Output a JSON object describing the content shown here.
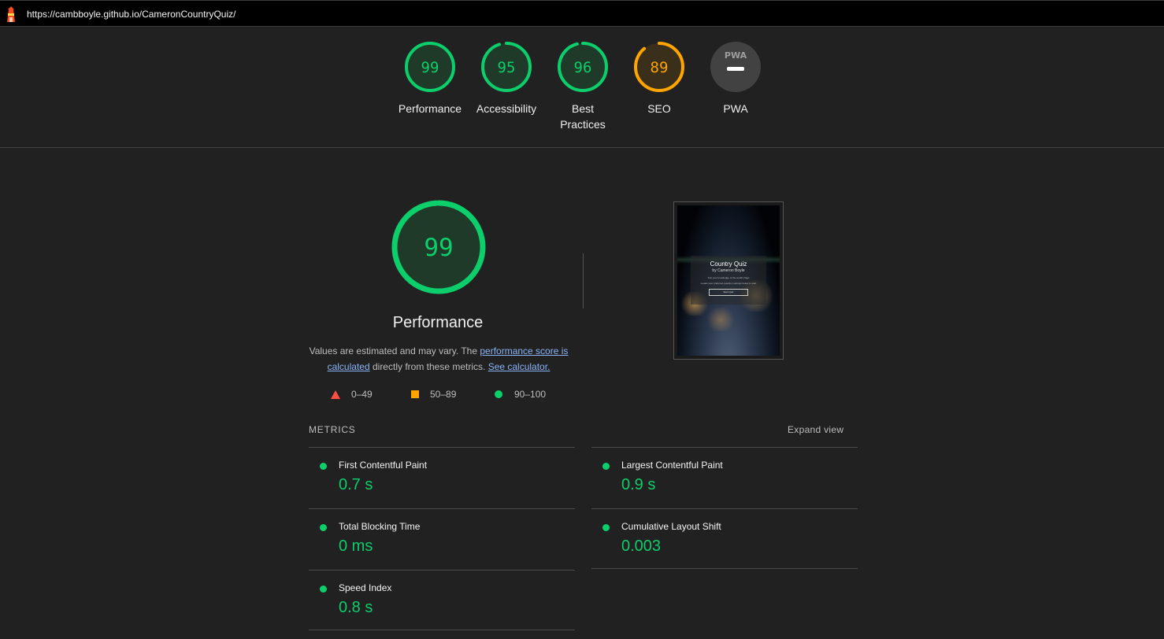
{
  "topbar": {
    "url": "https://cambboyle.github.io/CameronCountryQuiz/"
  },
  "colors": {
    "pass": "#0cce6b",
    "average": "#ffa400",
    "fail": "#ff4e42",
    "pwa": "#9e9e9e"
  },
  "gauges": [
    {
      "score": "99",
      "value": 99,
      "label": "Performance",
      "status": "pass"
    },
    {
      "score": "95",
      "value": 95,
      "label": "Accessibility",
      "status": "pass"
    },
    {
      "score": "96",
      "value": 96,
      "label": "Best Practices",
      "status": "pass"
    },
    {
      "score": "89",
      "value": 89,
      "label": "SEO",
      "status": "average"
    },
    {
      "badge": "PWA",
      "label": "PWA",
      "status": "pwa"
    }
  ],
  "performance": {
    "score": "99",
    "value": 99,
    "title": "Performance",
    "desc_prefix": "Values are estimated and may vary. The ",
    "desc_link1": "performance score is calculated",
    "desc_middle": " directly from these metrics. ",
    "desc_link2": "See calculator."
  },
  "legend": [
    {
      "icon": "triangle-icon",
      "range": "0–49"
    },
    {
      "icon": "square-icon",
      "range": "50–89"
    },
    {
      "icon": "circle-icon",
      "range": "90–100"
    }
  ],
  "screenshot": {
    "title": "Country Quiz",
    "subtitle": "by Cameron Boyle",
    "line1": "Test your knowledge of the world's flags",
    "line2": "Locate your preferred question settings below to start",
    "button": "Start Quiz"
  },
  "metrics": {
    "heading": "METRICS",
    "expand": "Expand view",
    "items": [
      {
        "title": "First Contentful Paint",
        "value": "0.7 s"
      },
      {
        "title": "Largest Contentful Paint",
        "value": "0.9 s"
      },
      {
        "title": "Total Blocking Time",
        "value": "0 ms"
      },
      {
        "title": "Cumulative Layout Shift",
        "value": "0.003"
      },
      {
        "title": "Speed Index",
        "value": "0.8 s"
      }
    ]
  }
}
